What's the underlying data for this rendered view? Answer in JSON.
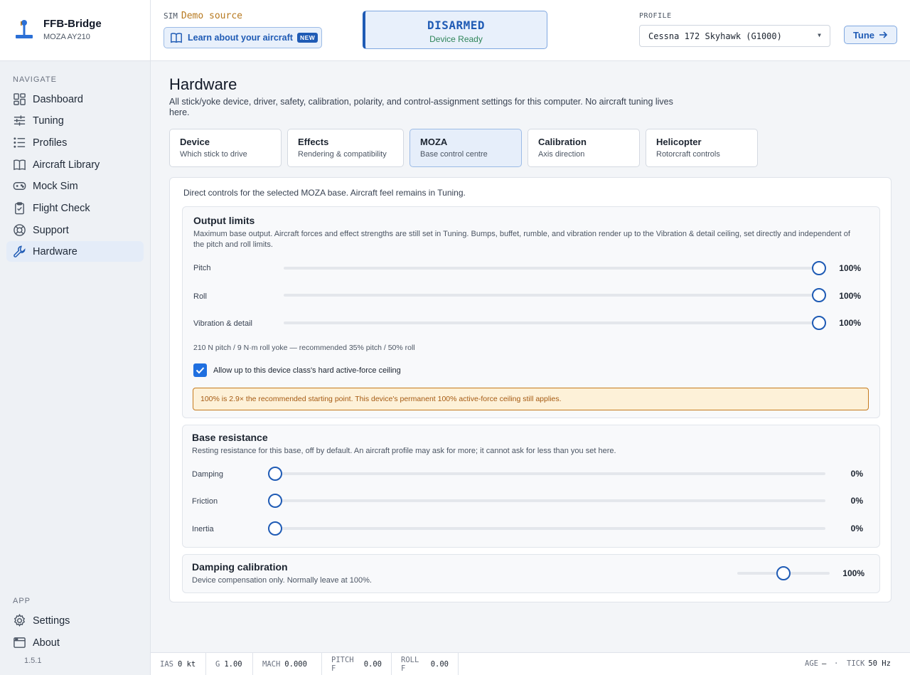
{
  "brand": {
    "title": "FFB-Bridge",
    "subtitle": "MOZA AY210"
  },
  "nav": {
    "heading": "NAVIGATE",
    "items": [
      {
        "label": "Dashboard",
        "icon": "dashboard-icon"
      },
      {
        "label": "Tuning",
        "icon": "sliders-icon"
      },
      {
        "label": "Profiles",
        "icon": "list-icon"
      },
      {
        "label": "Aircraft Library",
        "icon": "book-icon"
      },
      {
        "label": "Mock Sim",
        "icon": "gamepad-icon"
      },
      {
        "label": "Flight Check",
        "icon": "clipboard-check-icon"
      },
      {
        "label": "Support",
        "icon": "lifebuoy-icon"
      },
      {
        "label": "Hardware",
        "icon": "wrench-icon",
        "active": true
      }
    ],
    "app_heading": "APP",
    "app_items": [
      {
        "label": "Settings",
        "icon": "gear-icon"
      },
      {
        "label": "About",
        "icon": "window-icon"
      }
    ],
    "version": "1.5.1"
  },
  "topbar": {
    "sim_label": "SIM",
    "sim_source": "Demo source",
    "learn_label": "Learn about your aircraft",
    "learn_badge": "NEW",
    "arm_state": "DISARMED",
    "arm_sub": "Device Ready",
    "profile_label": "PROFILE",
    "profile_value": "Cessna 172 Skyhawk (G1000)",
    "tune_label": "Tune"
  },
  "page": {
    "title": "Hardware",
    "description": "All stick/yoke device, driver, safety, calibration, polarity, and control-assignment settings for this computer. No aircraft tuning lives here."
  },
  "tabs": [
    {
      "title": "Device",
      "subtitle": "Which stick to drive"
    },
    {
      "title": "Effects",
      "subtitle": "Rendering & compatibility"
    },
    {
      "title": "MOZA",
      "subtitle": "Base control centre",
      "active": true
    },
    {
      "title": "Calibration",
      "subtitle": "Axis direction"
    },
    {
      "title": "Helicopter",
      "subtitle": "Rotorcraft controls"
    }
  ],
  "moza": {
    "intro": "Direct controls for the selected MOZA base. Aircraft feel remains in Tuning.",
    "output_limits": {
      "title": "Output limits",
      "description": "Maximum base output. Aircraft forces and effect strengths are still set in Tuning. Bumps, buffet, rumble, and vibration render up to the Vibration & detail ceiling, set directly and independent of the pitch and roll limits.",
      "sliders": [
        {
          "label": "Pitch",
          "value": 100,
          "display": "100%"
        },
        {
          "label": "Roll",
          "value": 100,
          "display": "100%"
        },
        {
          "label": "Vibration & detail",
          "value": 100,
          "display": "100%"
        }
      ],
      "note": "210 N pitch / 9 N·m roll yoke — recommended 35% pitch / 50% roll",
      "checkbox_label": "Allow up to this device class's hard active-force ceiling",
      "checkbox_checked": true,
      "warning": "100% is 2.9× the recommended starting point. This device's permanent 100% active-force ceiling still applies."
    },
    "base_resistance": {
      "title": "Base resistance",
      "description": "Resting resistance for this base, off by default. An aircraft profile may ask for more; it cannot ask for less than you set here.",
      "sliders": [
        {
          "label": "Damping",
          "value": 0,
          "display": "0%"
        },
        {
          "label": "Friction",
          "value": 0,
          "display": "0%"
        },
        {
          "label": "Inertia",
          "value": 0,
          "display": "0%"
        }
      ]
    },
    "damping_calibration": {
      "title": "Damping calibration",
      "description": "Device compensation only. Normally leave at 100%.",
      "value": 50,
      "display": "100%"
    }
  },
  "statusbar": {
    "ias_label": "IAS",
    "ias_value": "0 kt",
    "g_label": "G",
    "g_value": "1.00",
    "mach_label": "MACH",
    "mach_value": "0.000",
    "pitchf_label": "PITCH F",
    "pitchf_value": "0.00",
    "rollf_label": "ROLL F",
    "rollf_value": "0.00",
    "age_label": "AGE",
    "age_value": "—",
    "sep": "·",
    "tick_label": "TICK",
    "tick_value": "50 Hz"
  },
  "colors": {
    "accent": "#1f5bb5",
    "warning_bg": "#fdf1d8",
    "warning_text": "#a55a12",
    "ready": "#2f855a"
  }
}
